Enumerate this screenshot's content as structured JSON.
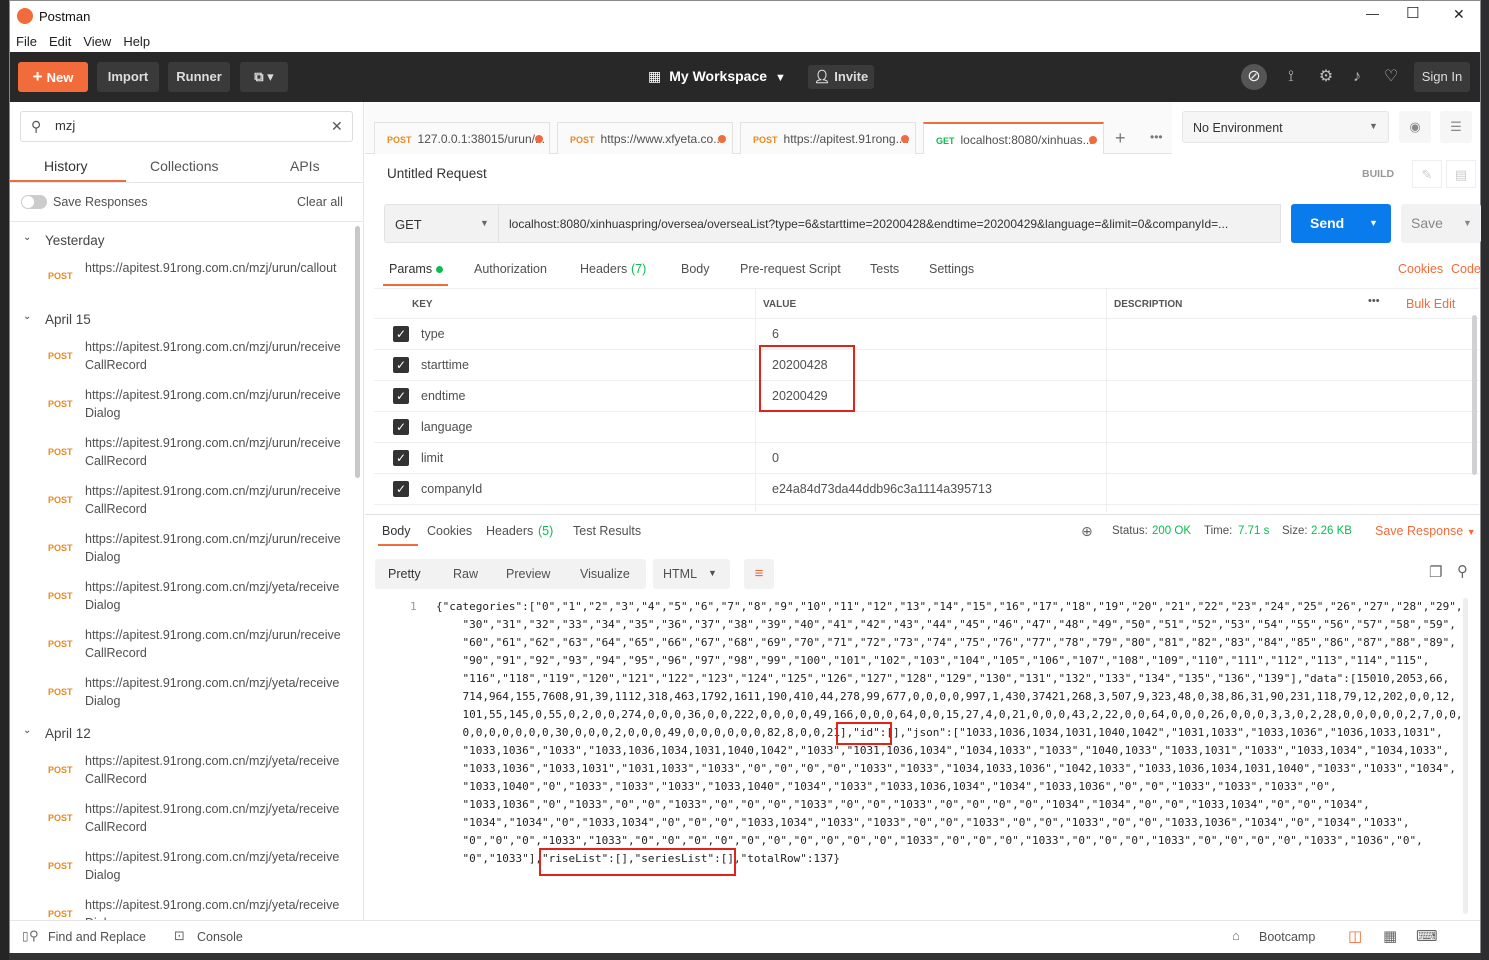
{
  "window": {
    "title": "Postman",
    "min": "—",
    "max": "☐",
    "close": "✕"
  },
  "menu": [
    "File",
    "Edit",
    "View",
    "Help"
  ],
  "header": {
    "new": "New",
    "import": "Import",
    "runner": "Runner",
    "workspace": "My Workspace",
    "invite": "Invite",
    "signin": "Sign In"
  },
  "sidebar": {
    "search_value": "mzj",
    "tabs": [
      "History",
      "Collections",
      "APIs"
    ],
    "save_responses": "Save Responses",
    "clear_all": "Clear all",
    "groups": [
      {
        "label": "Yesterday",
        "items": [
          {
            "method": "POST",
            "url": "https://apitest.91rong.com.cn/mzj/urun/callout"
          }
        ]
      },
      {
        "label": "April 15",
        "items": [
          {
            "method": "POST",
            "url": "https://apitest.91rong.com.cn/mzj/urun/receiveCallRecord"
          },
          {
            "method": "POST",
            "url": "https://apitest.91rong.com.cn/mzj/urun/receiveDialog"
          },
          {
            "method": "POST",
            "url": "https://apitest.91rong.com.cn/mzj/urun/receiveCallRecord"
          },
          {
            "method": "POST",
            "url": "https://apitest.91rong.com.cn/mzj/urun/receiveCallRecord"
          },
          {
            "method": "POST",
            "url": "https://apitest.91rong.com.cn/mzj/urun/receiveDialog"
          },
          {
            "method": "POST",
            "url": "https://apitest.91rong.com.cn/mzj/yeta/receiveDialog"
          },
          {
            "method": "POST",
            "url": "https://apitest.91rong.com.cn/mzj/urun/receiveCallRecord"
          },
          {
            "method": "POST",
            "url": "https://apitest.91rong.com.cn/mzj/yeta/receiveDialog"
          }
        ]
      },
      {
        "label": "April 12",
        "items": [
          {
            "method": "POST",
            "url": "https://apitest.91rong.com.cn/mzj/yeta/receiveCallRecord"
          },
          {
            "method": "POST",
            "url": "https://apitest.91rong.com.cn/mzj/yeta/receiveCallRecord"
          },
          {
            "method": "POST",
            "url": "https://apitest.91rong.com.cn/mzj/yeta/receiveDialog"
          },
          {
            "method": "POST",
            "url": "https://apitest.91rong.com.cn/mzj/yeta/receiveDialog"
          }
        ]
      }
    ]
  },
  "tabs": [
    {
      "method": "POST",
      "label": "127.0.0.1:38015/urun/..."
    },
    {
      "method": "POST",
      "label": "https://www.xfyeta.co..."
    },
    {
      "method": "POST",
      "label": "https://apitest.91rong...."
    },
    {
      "method": "GET",
      "label": "localhost:8080/xinhuas..."
    }
  ],
  "environment": "No Environment",
  "request": {
    "title": "Untitled Request",
    "build": "BUILD",
    "method": "GET",
    "url": "localhost:8080/xinhuaspring/oversea/overseaList?type=6&starttime=20200428&endtime=20200429&language=&limit=0&companyId=...",
    "send": "Send",
    "save": "Save",
    "tabs": [
      "Params",
      "Authorization",
      "Headers",
      "(7)",
      "Body",
      "Pre-request Script",
      "Tests",
      "Settings"
    ],
    "cookies": "Cookies",
    "code": "Code",
    "columns": [
      "KEY",
      "VALUE",
      "DESCRIPTION"
    ],
    "bulk_edit": "Bulk Edit",
    "params": [
      {
        "key": "type",
        "value": "6"
      },
      {
        "key": "starttime",
        "value": "20200428"
      },
      {
        "key": "endtime",
        "value": "20200429"
      },
      {
        "key": "language",
        "value": ""
      },
      {
        "key": "limit",
        "value": "0"
      },
      {
        "key": "companyId",
        "value": "e24a84d73da44ddb96c3a1114a395713"
      }
    ]
  },
  "response": {
    "tabs": [
      "Body",
      "Cookies",
      "Headers",
      "(5)",
      "Test Results"
    ],
    "status_label": "Status:",
    "status": "200 OK",
    "time_label": "Time:",
    "time": "7.71 s",
    "size_label": "Size:",
    "size": "2.26 KB",
    "save_response": "Save Response",
    "views": [
      "Pretty",
      "Raw",
      "Preview",
      "Visualize"
    ],
    "format": "HTML",
    "line_no": "1",
    "lines": [
      "{\"categories\":[\"0\",\"1\",\"2\",\"3\",\"4\",\"5\",\"6\",\"7\",\"8\",\"9\",\"10\",\"11\",\"12\",\"13\",\"14\",\"15\",\"16\",\"17\",\"18\",\"19\",\"20\",\"21\",\"22\",\"23\",\"24\",\"25\",\"26\",\"27\",\"28\",\"29\",",
      "    \"30\",\"31\",\"32\",\"33\",\"34\",\"35\",\"36\",\"37\",\"38\",\"39\",\"40\",\"41\",\"42\",\"43\",\"44\",\"45\",\"46\",\"47\",\"48\",\"49\",\"50\",\"51\",\"52\",\"53\",\"54\",\"55\",\"56\",\"57\",\"58\",\"59\",",
      "    \"60\",\"61\",\"62\",\"63\",\"64\",\"65\",\"66\",\"67\",\"68\",\"69\",\"70\",\"71\",\"72\",\"73\",\"74\",\"75\",\"76\",\"77\",\"78\",\"79\",\"80\",\"81\",\"82\",\"83\",\"84\",\"85\",\"86\",\"87\",\"88\",\"89\",",
      "    \"90\",\"91\",\"92\",\"93\",\"94\",\"95\",\"96\",\"97\",\"98\",\"99\",\"100\",\"101\",\"102\",\"103\",\"104\",\"105\",\"106\",\"107\",\"108\",\"109\",\"110\",\"111\",\"112\",\"113\",\"114\",\"115\",",
      "    \"116\",\"118\",\"119\",\"120\",\"121\",\"122\",\"123\",\"124\",\"125\",\"126\",\"127\",\"128\",\"129\",\"130\",\"131\",\"132\",\"133\",\"134\",\"135\",\"136\",\"139\"],\"data\":[15010,2053,66,",
      "    714,964,155,7608,91,39,1112,318,463,1792,1611,190,410,44,278,99,677,0,0,0,0,997,1,430,37421,268,3,507,9,323,48,0,38,86,31,90,231,118,79,12,202,0,0,12,",
      "    101,55,145,0,55,0,2,0,0,274,0,0,0,36,0,0,222,0,0,0,0,49,166,0,0,0,64,0,0,15,27,4,0,21,0,0,0,43,2,22,0,0,64,0,0,0,26,0,0,0,3,3,0,2,28,0,0,0,0,0,2,7,0,0,",
      "    0,0,0,0,0,0,0,30,0,0,0,2,0,0,0,49,0,0,0,0,0,0,82,8,0,0,21],\"id\":[],\"json\":[\"1033,1036,1034,1031,1040,1042\",\"1031,1033\",\"1033,1036\",\"1036,1033,1031\",",
      "    \"1033,1036\",\"1033\",\"1033,1036,1034,1031,1040,1042\",\"1033\",\"1031,1036,1034\",\"1034,1033\",\"1033\",\"1040,1033\",\"1033,1031\",\"1033\",\"1033,1034\",\"1034,1033\",",
      "    \"1033,1036\",\"1033,1031\",\"1031,1033\",\"1033\",\"0\",\"0\",\"0\",\"0\",\"1033\",\"1033\",\"1034,1033,1036\",\"1042,1033\",\"1033,1036,1034,1031,1040\",\"1033\",\"1033\",\"1034\",",
      "    \"1033,1040\",\"0\",\"1033\",\"1033\",\"1033\",\"1033,1040\",\"1034\",\"1033\",\"1033,1036,1034\",\"1034\",\"1033,1036\",\"0\",\"0\",\"1033\",\"1033\",\"1033\",\"0\",",
      "    \"1033,1036\",\"0\",\"1033\",\"0\",\"0\",\"1033\",\"0\",\"0\",\"0\",\"1033\",\"0\",\"0\",\"1033\",\"0\",\"0\",\"0\",\"0\",\"1034\",\"1034\",\"0\",\"0\",\"1033,1034\",\"0\",\"0\",\"1034\",",
      "    \"1034\",\"1034\",\"0\",\"1033,1034\",\"0\",\"0\",\"0\",\"1033,1034\",\"1033\",\"1033\",\"0\",\"0\",\"1033\",\"0\",\"0\",\"1033\",\"0\",\"0\",\"1033,1036\",\"1034\",\"0\",\"1034\",\"1033\",",
      "    \"0\",\"0\",\"0\",\"1033\",\"1033\",\"0\",\"0\",\"0\",\"0\",\"0\",\"0\",\"0\",\"0\",\"0\",\"0\",\"1033\",\"0\",\"0\",\"0\",\"1033\",\"0\",\"0\",\"0\",\"1033\",\"0\",\"0\",\"0\",\"0\",\"1033\",\"1036\",\"0\",",
      "    \"0\",\"1033\"],\"riseList\":[],\"seriesList\":[],\"totalRow\":137}"
    ]
  },
  "statusbar": {
    "find": "Find and Replace",
    "console": "Console",
    "bootcamp": "Bootcamp"
  },
  "colors": {
    "orange": "#f26b3a",
    "blue": "#097bed",
    "green": "#0cbb52"
  }
}
